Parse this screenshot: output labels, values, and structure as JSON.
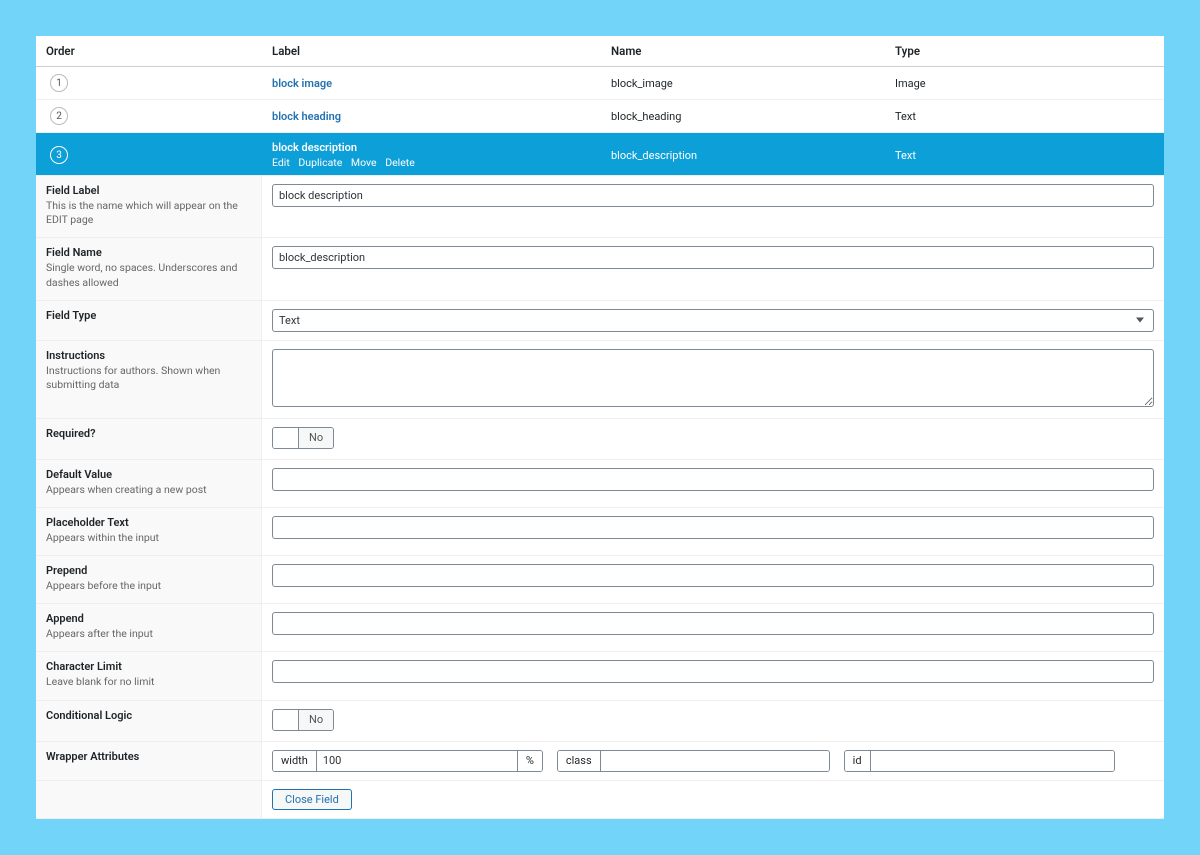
{
  "columns": {
    "order": "Order",
    "label": "Label",
    "name": "Name",
    "type": "Type"
  },
  "rows": [
    {
      "order": "1",
      "label": "block image",
      "name": "block_image",
      "type": "Image"
    },
    {
      "order": "2",
      "label": "block heading",
      "name": "block_heading",
      "type": "Text"
    },
    {
      "order": "3",
      "label": "block description",
      "name": "block_description",
      "type": "Text",
      "actions": {
        "edit": "Edit",
        "duplicate": "Duplicate",
        "move": "Move",
        "delete": "Delete"
      }
    }
  ],
  "settings": {
    "field_label": {
      "title": "Field Label",
      "desc": "This is the name which will appear on the EDIT page",
      "value": "block description"
    },
    "field_name": {
      "title": "Field Name",
      "desc": "Single word, no spaces. Underscores and dashes allowed",
      "value": "block_description"
    },
    "field_type": {
      "title": "Field Type",
      "value": "Text"
    },
    "instructions": {
      "title": "Instructions",
      "desc": "Instructions for authors. Shown when submitting data",
      "value": ""
    },
    "required": {
      "title": "Required?",
      "value": "No"
    },
    "default_value": {
      "title": "Default Value",
      "desc": "Appears when creating a new post",
      "value": ""
    },
    "placeholder_text": {
      "title": "Placeholder Text",
      "desc": "Appears within the input",
      "value": ""
    },
    "prepend": {
      "title": "Prepend",
      "desc": "Appears before the input",
      "value": ""
    },
    "append": {
      "title": "Append",
      "desc": "Appears after the input",
      "value": ""
    },
    "character_limit": {
      "title": "Character Limit",
      "desc": "Leave blank for no limit",
      "value": ""
    },
    "conditional_logic": {
      "title": "Conditional Logic",
      "value": "No"
    },
    "wrapper": {
      "title": "Wrapper Attributes",
      "width_label": "width",
      "width_value": "100",
      "width_unit": "%",
      "class_label": "class",
      "class_value": "",
      "id_label": "id",
      "id_value": ""
    },
    "close": "Close Field"
  }
}
